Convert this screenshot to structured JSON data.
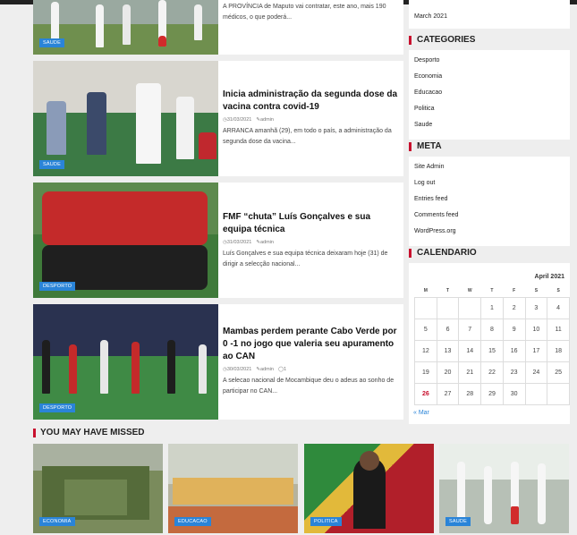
{
  "posts": [
    {
      "title": "",
      "date": "",
      "author": "",
      "excerpt": "A PROVÍNCIA de Maputo vai contratar, este ano, mais 190 médicos, o que poderá...",
      "category": "SAUDE"
    },
    {
      "title": "Inicia administração da segunda dose da vacina contra covid-19",
      "date": "31/03/2021",
      "author": "admin",
      "excerpt": "ARRANCA amanhã (29), em todo o país, a administração da segunda dose da vacina...",
      "category": "SAUDE"
    },
    {
      "title": "FMF “chuta” Luís Gonçalves e sua equipa técnica",
      "date": "31/03/2021",
      "author": "admin",
      "excerpt": "Luís Gonçalves e sua equipa técnica deixaram hoje (31) de dirigir a selecção nacional...",
      "category": "DESPORTO"
    },
    {
      "title": "Mambas perdem perante Cabo Verde por 0 -1 no jogo que valeria seu apuramento ao CAN",
      "date": "30/03/2021",
      "author": "admin",
      "comments": "1",
      "excerpt": "A selecao nacional de Mocambique deu o adeus ao sonho de participar no CAN...",
      "category": "DESPORTO"
    }
  ],
  "sidebar": {
    "archive_item": "March 2021",
    "categories_title": "CATEGORIES",
    "categories": [
      "Desporto",
      "Economia",
      "Educacao",
      "Politica",
      "Saude"
    ],
    "meta_title": "META",
    "meta_links": [
      "Site Admin",
      "Log out",
      "Entries feed",
      "Comments feed",
      "WordPress.org"
    ],
    "calendar_title": "CALENDARIO",
    "calendar": {
      "caption": "April 2021",
      "weekdays": [
        "M",
        "T",
        "W",
        "T",
        "F",
        "S",
        "S"
      ],
      "weeks": [
        [
          "",
          "",
          "",
          "1",
          "2",
          "3",
          "4"
        ],
        [
          "5",
          "6",
          "7",
          "8",
          "9",
          "10",
          "11"
        ],
        [
          "12",
          "13",
          "14",
          "15",
          "16",
          "17",
          "18"
        ],
        [
          "19",
          "20",
          "21",
          "22",
          "23",
          "24",
          "25"
        ],
        [
          "26",
          "27",
          "28",
          "29",
          "30",
          "",
          ""
        ]
      ],
      "today": "26",
      "prev_link": "« Mar"
    }
  },
  "missed": {
    "title": "YOU MAY HAVE MISSED",
    "items": [
      {
        "category": "ECONOMIA"
      },
      {
        "category": "EDUCACAO"
      },
      {
        "category": "POLITICA"
      },
      {
        "category": "SAUDE"
      }
    ]
  },
  "colors": {
    "accent": "#c8102e",
    "badge": "#2a84d8"
  }
}
